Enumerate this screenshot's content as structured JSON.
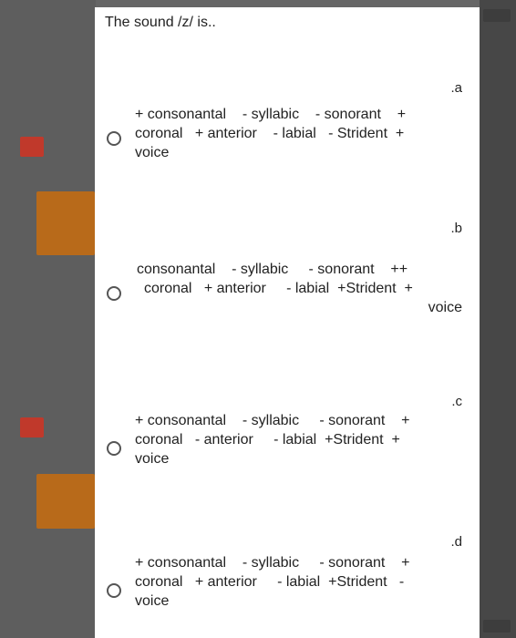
{
  "question": "The sound /z/ is..",
  "options": [
    {
      "letter": ".a",
      "lines": [
        "+ consonantal    - syllabic    - sonorant    +",
        "coronal   + anterior    - labial   - Strident  +",
        "voice"
      ]
    },
    {
      "letter": ".b",
      "lines": [
        "consonantal    - syllabic     - sonorant    ++",
        "coronal   + anterior     - labial  +Strident  +",
        "voice"
      ]
    },
    {
      "letter": ".c",
      "lines": [
        "+ consonantal    - syllabic     - sonorant    +",
        "coronal   - anterior     - labial  +Strident  +",
        "voice"
      ]
    },
    {
      "letter": ".d",
      "lines": [
        "+ consonantal    - syllabic     - sonorant    +",
        "coronal   + anterior     - labial  +Strident   -",
        "voice"
      ]
    }
  ]
}
